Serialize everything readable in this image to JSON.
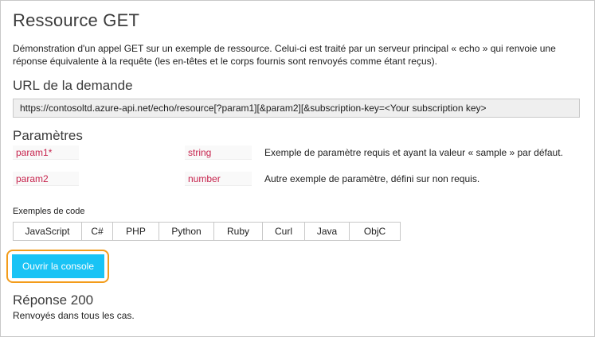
{
  "title": "Ressource GET",
  "description": "Démonstration d'un appel GET sur un exemple de ressource. Celui-ci est traité par un serveur principal « echo » qui renvoie une réponse équivalente à la requête (les en-têtes et le corps fournis sont renvoyés comme étant reçus).",
  "request_url": {
    "heading": "URL de la demande",
    "value": "https://contosoltd.azure-api.net/echo/resource[?param1][&param2][&subscription-key=<Your subscription key>"
  },
  "parameters": {
    "heading": "Paramètres",
    "items": [
      {
        "name": "param1*",
        "type": "string",
        "description": "Exemple de paramètre requis et ayant la valeur « sample » par défaut."
      },
      {
        "name": "param2",
        "type": "number",
        "description": "Autre exemple de paramètre, défini sur non requis."
      }
    ]
  },
  "code_samples": {
    "label": "Exemples de code",
    "tabs": [
      "JavaScript",
      "C#",
      "PHP",
      "Python",
      "Ruby",
      "Curl",
      "Java",
      "ObjC"
    ]
  },
  "console_button": {
    "label": "Ouvrir la console"
  },
  "response": {
    "heading": "Réponse 200",
    "text": "Renvoyés dans tous les cas."
  },
  "colors": {
    "accent_button": "#19c3f5",
    "highlight_outline": "#f39c1a",
    "param_text": "#c7254e"
  }
}
